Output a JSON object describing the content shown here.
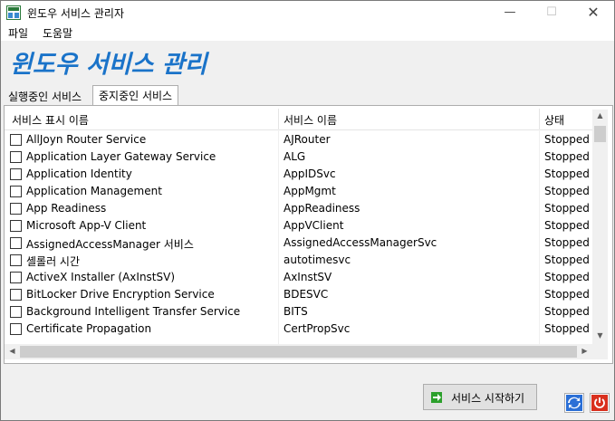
{
  "window": {
    "title": "윈도우 서비스 관리자",
    "min_glyph": "—",
    "max_glyph": "☐",
    "close_glyph": "✕"
  },
  "menu": [
    "파일",
    "도움말"
  ],
  "heading": "윈도우 서비스 관리",
  "tabs": [
    {
      "label": "실행중인 서비스",
      "active": false
    },
    {
      "label": "중지중인 서비스",
      "active": true
    }
  ],
  "table": {
    "columns": [
      "서비스 표시 이름",
      "서비스 이름",
      "상태"
    ],
    "rows": [
      {
        "display_name": "AllJoyn Router Service",
        "service_name": "AJRouter",
        "status": "Stopped"
      },
      {
        "display_name": "Application Layer Gateway Service",
        "service_name": "ALG",
        "status": "Stopped"
      },
      {
        "display_name": "Application Identity",
        "service_name": "AppIDSvc",
        "status": "Stopped"
      },
      {
        "display_name": "Application Management",
        "service_name": "AppMgmt",
        "status": "Stopped"
      },
      {
        "display_name": "App Readiness",
        "service_name": "AppReadiness",
        "status": "Stopped"
      },
      {
        "display_name": "Microsoft App-V Client",
        "service_name": "AppVClient",
        "status": "Stopped"
      },
      {
        "display_name": "AssignedAccessManager 서비스",
        "service_name": "AssignedAccessManagerSvc",
        "status": "Stopped"
      },
      {
        "display_name": "셸롤러 시간",
        "service_name": "autotimesvc",
        "status": "Stopped"
      },
      {
        "display_name": "ActiveX Installer (AxInstSV)",
        "service_name": "AxInstSV",
        "status": "Stopped"
      },
      {
        "display_name": "BitLocker Drive Encryption Service",
        "service_name": "BDESVC",
        "status": "Stopped"
      },
      {
        "display_name": "Background Intelligent Transfer Service",
        "service_name": "BITS",
        "status": "Stopped"
      },
      {
        "display_name": "Certificate Propagation",
        "service_name": "CertPropSvc",
        "status": "Stopped"
      }
    ]
  },
  "actions": {
    "start_label": "서비스 시작하기"
  },
  "icons": {
    "app": "app-icon",
    "start": "arrow-right-icon",
    "refresh": "refresh-icon",
    "power": "power-icon"
  },
  "colors": {
    "heading": "#1a73c9",
    "start_icon": "#2ca02c",
    "refresh": "#2b6fd6",
    "power": "#d9301e"
  }
}
